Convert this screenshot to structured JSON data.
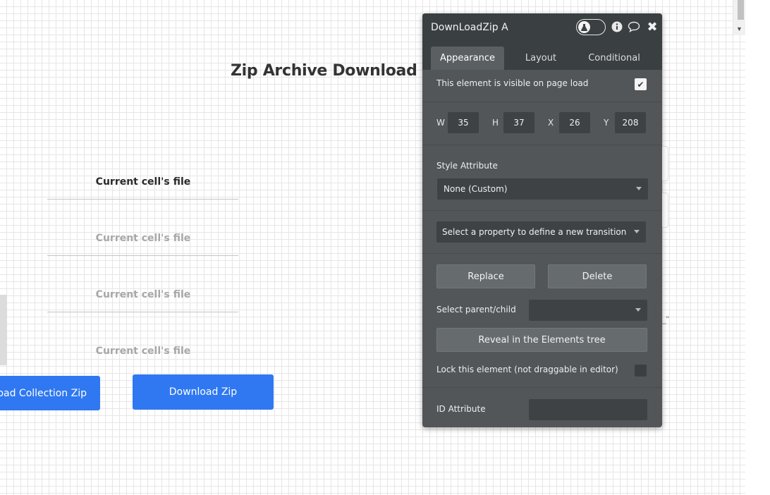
{
  "canvas": {
    "heading": "Zip Archive Download",
    "cells": [
      "Current cell's file",
      "Current cell's file",
      "Current cell's file",
      "Current cell's file"
    ],
    "buttons": {
      "collection": "load Collection Zip",
      "download": "Download Zip"
    },
    "ghost_quote": "_\""
  },
  "panel": {
    "title": "DownLoadZip A",
    "tabs": [
      "Appearance",
      "Layout",
      "Conditional"
    ],
    "active_tab": "Appearance",
    "visible_on_load_label": "This element is visible on page load",
    "visible_on_load_checked": true,
    "dimensions": {
      "w_label": "W",
      "w": "35",
      "h_label": "H",
      "h": "37",
      "x_label": "X",
      "x": "26",
      "y_label": "Y",
      "y": "208"
    },
    "style_attribute_label": "Style Attribute",
    "style_attribute_value": "None (Custom)",
    "transition_placeholder": "Select a property to define a new transition",
    "replace_label": "Replace",
    "delete_label": "Delete",
    "select_parent_label": "Select parent/child",
    "select_parent_value": "",
    "reveal_label": "Reveal in the Elements tree",
    "lock_label": "Lock this element (not draggable in editor)",
    "lock_checked": false,
    "id_attribute_label": "ID Attribute",
    "id_attribute_value": ""
  },
  "colors": {
    "panel_bg": "#525659",
    "panel_header": "#3a3f42",
    "accent_blue": "#2f78f1"
  },
  "icons": [
    "flask-icon",
    "info-icon",
    "comment-icon",
    "close-icon",
    "check-icon",
    "chevron-down-icon"
  ]
}
